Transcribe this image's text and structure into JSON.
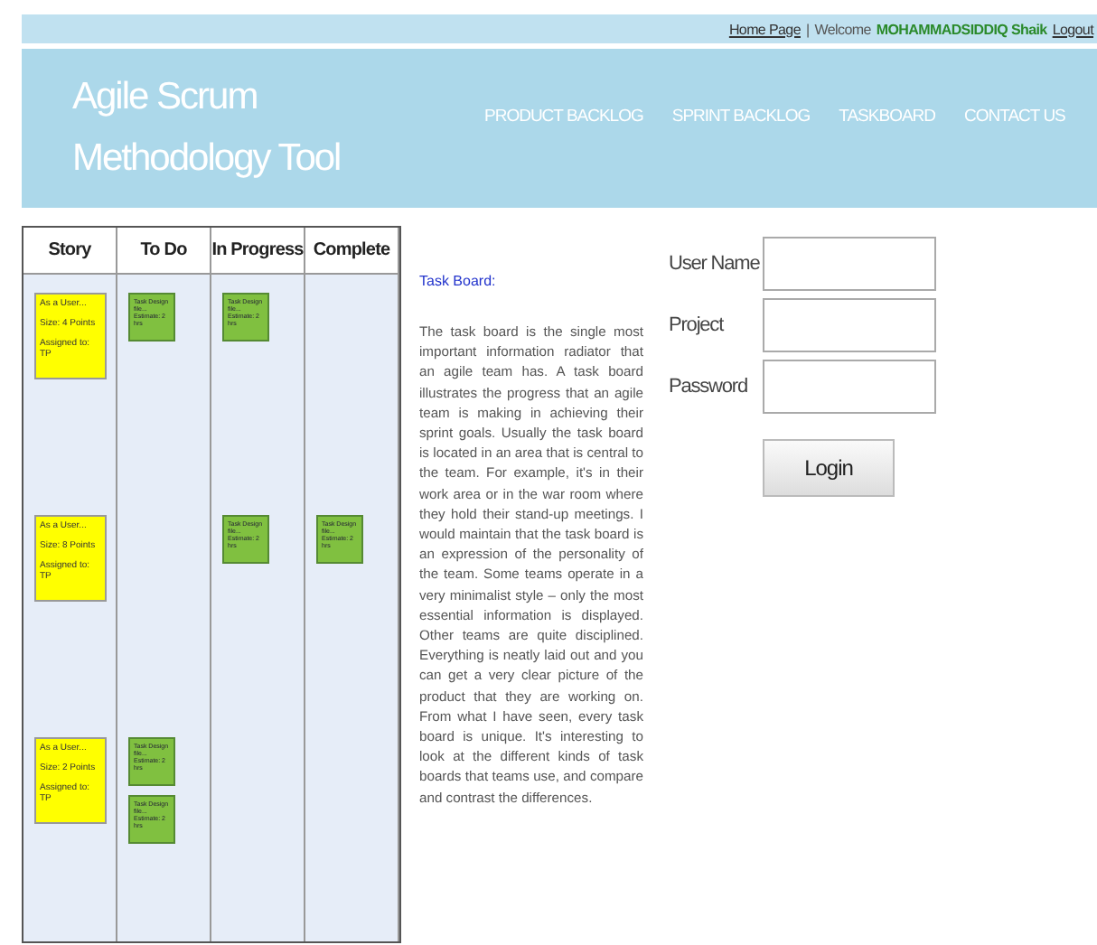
{
  "top_bar": {
    "home_link": "Home Page",
    "separator": "|",
    "welcome": "Welcome",
    "user": "MOHAMMADSIDDIQ Shaik",
    "logout": "Logout"
  },
  "header": {
    "title": "Agile Scrum Methodology Tool",
    "nav": [
      "PRODUCT BACKLOG",
      "SPRINT BACKLOG",
      "TASKBOARD",
      "CONTACT US"
    ]
  },
  "taskboard": {
    "columns": [
      "Story",
      "To Do",
      "In Progress",
      "Complete"
    ],
    "lanes": [
      {
        "cells": [
          [
            {
              "kind": "story",
              "lines": [
                "As a User...",
                "Size: 4 Points",
                "Assigned to: TP"
              ]
            }
          ],
          [
            {
              "kind": "task",
              "lines": [
                "Task Design",
                "file...",
                "Estimate: 2 hrs"
              ]
            }
          ],
          [
            {
              "kind": "task",
              "lines": [
                "Task Design",
                "file...",
                "Estimate: 2 hrs"
              ]
            }
          ],
          []
        ]
      },
      {
        "cells": [
          [
            {
              "kind": "story",
              "lines": [
                "As a User...",
                "Size: 8 Points",
                "Assigned to: TP"
              ]
            }
          ],
          [],
          [
            {
              "kind": "task",
              "lines": [
                "Task Design",
                "file...",
                "Estimate: 2 hrs"
              ]
            }
          ],
          [
            {
              "kind": "task",
              "lines": [
                "Task Design",
                "file...",
                "Estimate: 2 hrs"
              ]
            }
          ]
        ]
      },
      {
        "cells": [
          [
            {
              "kind": "story",
              "lines": [
                "As a User...",
                "Size: 2 Points",
                "Assigned to: TP"
              ]
            }
          ],
          [
            {
              "kind": "task",
              "lines": [
                "Task Design",
                "file...",
                "Estimate: 2 hrs"
              ]
            },
            {
              "kind": "task",
              "lines": [
                "Task Design",
                "file...",
                "Estimate: 2 hrs"
              ]
            }
          ],
          [],
          []
        ]
      }
    ]
  },
  "article": {
    "heading": "Task Board:",
    "body": "The task board is the single most important information radiator that an agile team has. A task board illustrates the progress that an agile team is making in achieving their sprint goals. Usually the task board is located in an area that is central to the team. For example, it's in their work area or in the war room where they hold their stand-up meetings. I would maintain that the task board is an expression of the personality of the team. Some teams operate in a very minimalist style – only the most essential information is displayed. Other teams are quite disciplined. Everything is neatly laid out and you can get a very clear picture of the product that they are working on. From what I have seen, every task board is unique. It's interesting to look at the different kinds of task boards that teams use, and compare and contrast the differences."
  },
  "login": {
    "fields": [
      {
        "label": "User Name"
      },
      {
        "label": "Project"
      },
      {
        "label": "Password"
      }
    ],
    "button": "Login"
  }
}
